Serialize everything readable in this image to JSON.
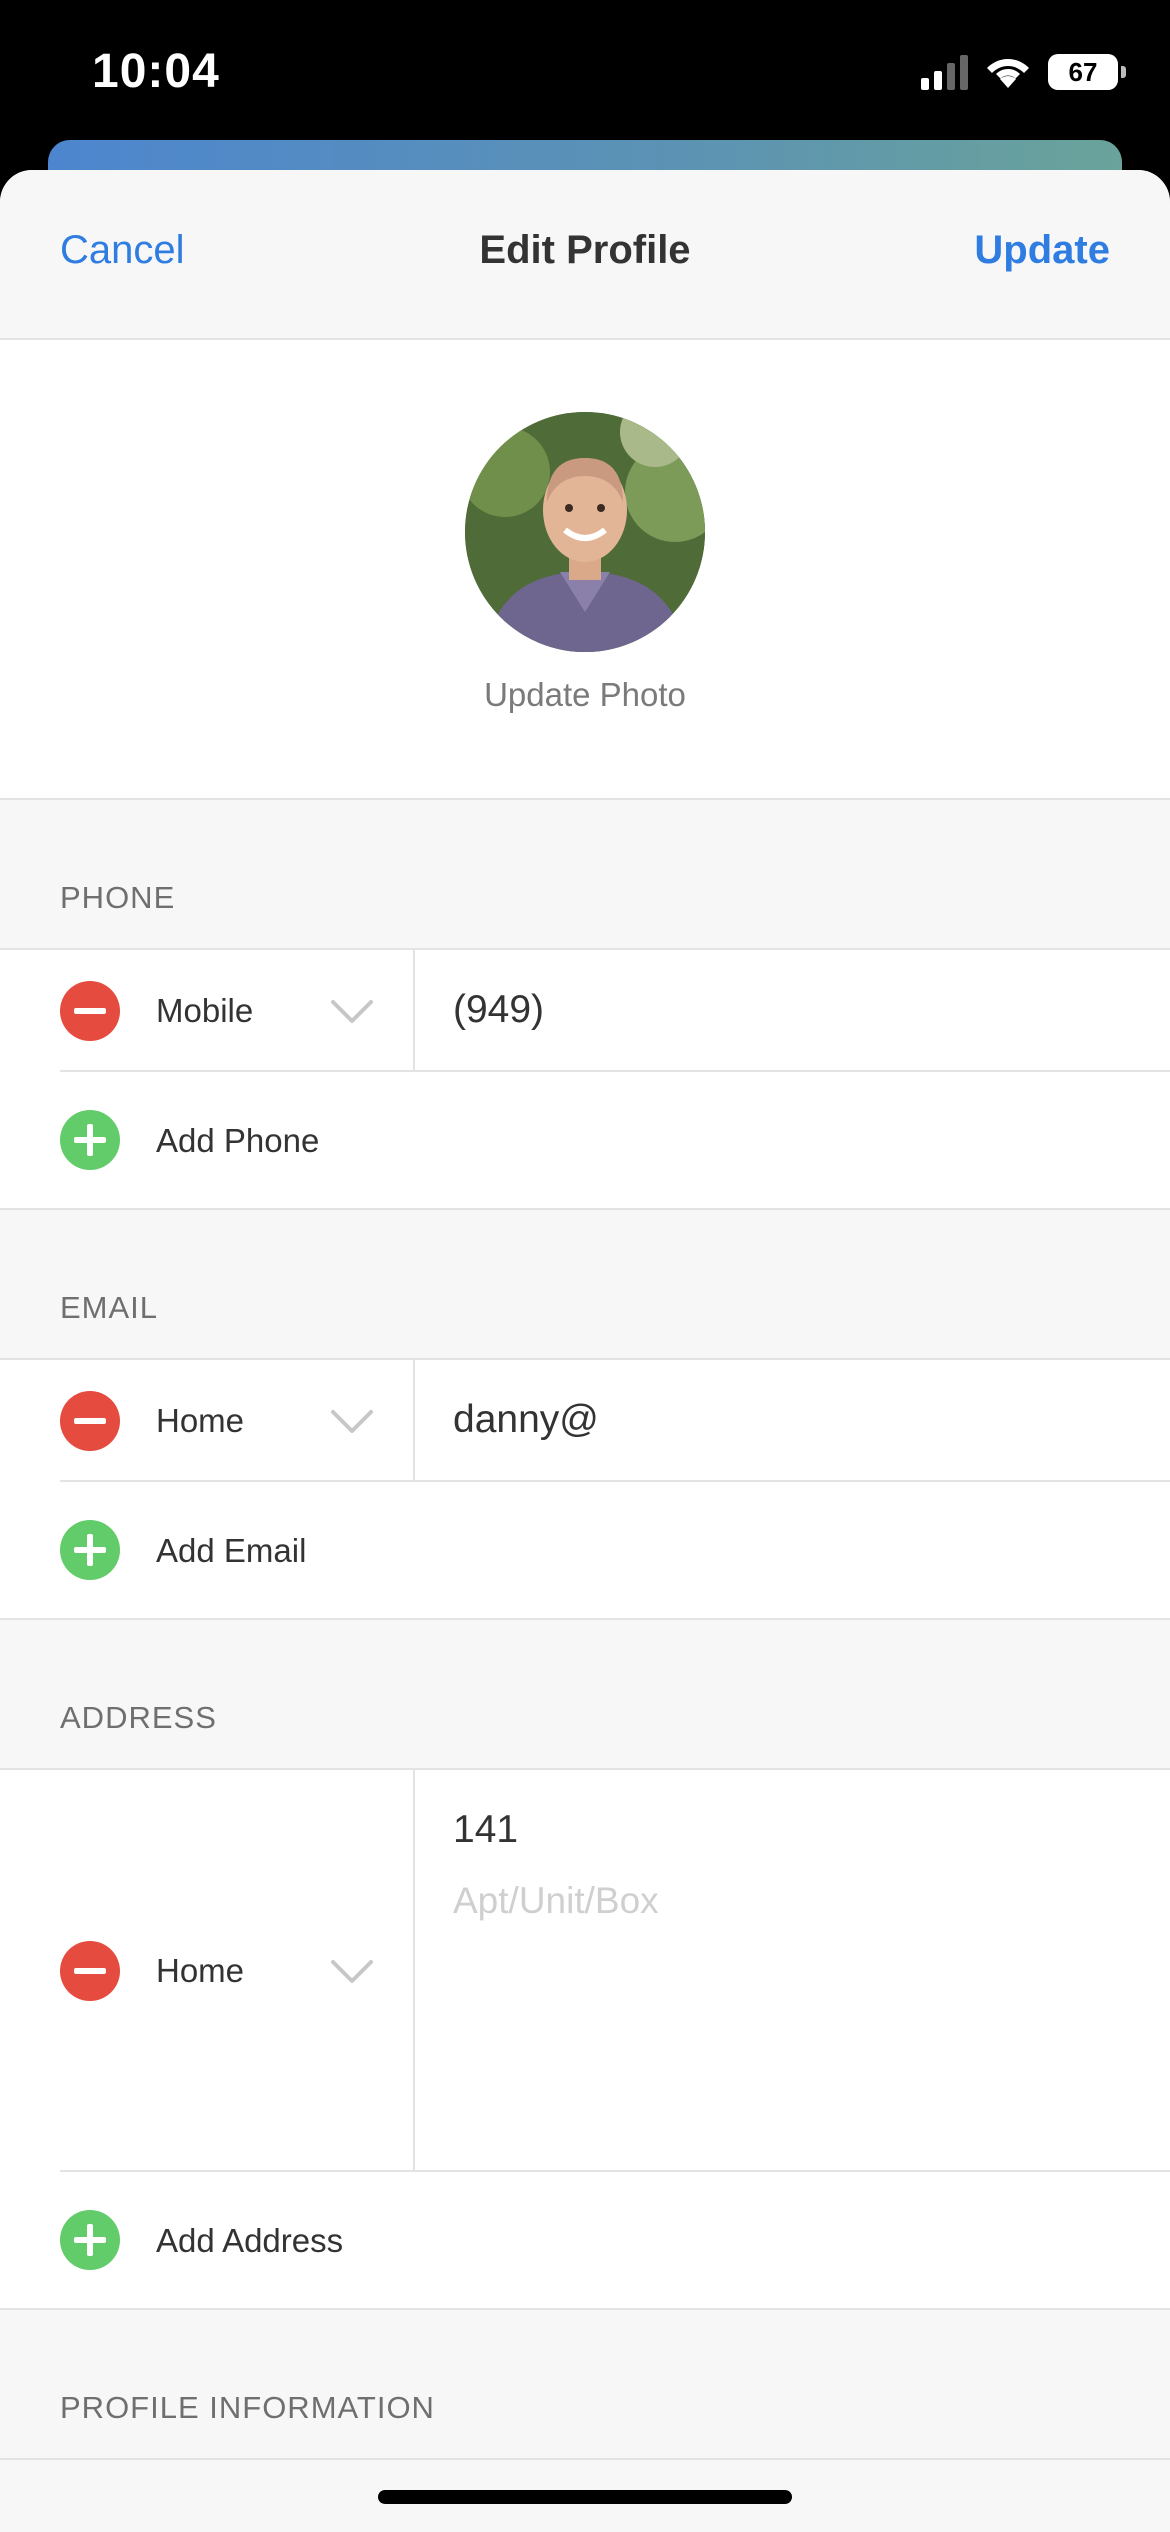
{
  "status_bar": {
    "time": "10:04",
    "battery": "67"
  },
  "nav": {
    "cancel_label": "Cancel",
    "title": "Edit Profile",
    "update_label": "Update"
  },
  "photo": {
    "update_label": "Update Photo"
  },
  "phone": {
    "header": "PHONE",
    "entry": {
      "type": "Mobile",
      "value": "(949)"
    },
    "add_label": "Add Phone"
  },
  "email": {
    "header": "EMAIL",
    "entry": {
      "type": "Home",
      "value": "danny@"
    },
    "add_label": "Add Email"
  },
  "address": {
    "header": "ADDRESS",
    "entry": {
      "type": "Home",
      "line1": "141",
      "line2_placeholder": "Apt/Unit/Box"
    },
    "add_label": "Add Address"
  },
  "profile_information": {
    "header": "PROFILE INFORMATION"
  },
  "colors": {
    "accent": "#2f7de1",
    "remove": "#e54b3e",
    "add": "#62cc6a"
  }
}
